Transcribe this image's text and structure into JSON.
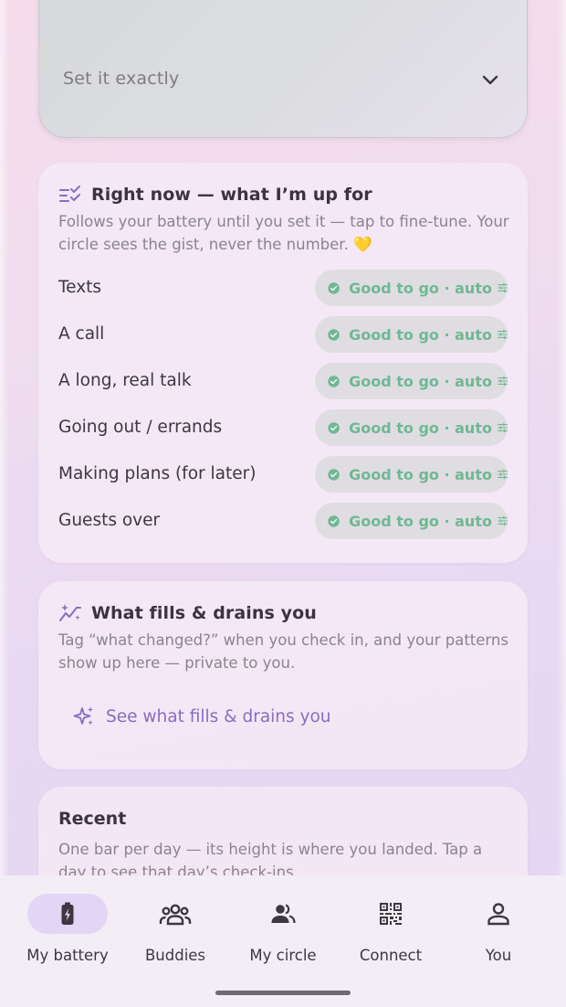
{
  "colors": {
    "accent": "#8a6cc0",
    "status_ok": "#6fb894",
    "nav_active_bg": "#e3d5f5"
  },
  "select": {
    "label": "Set it exactly",
    "icon": "chevron-down-icon"
  },
  "right_now": {
    "title": "Right now — what I’m up for",
    "icon": "tune-check-icon",
    "description": "Follows your battery until you set it — tap to fine-tune. Your circle sees the gist, never the number. 💛",
    "rows": [
      {
        "label": "Texts",
        "status": "Good to go · auto"
      },
      {
        "label": "A call",
        "status": "Good to go · auto"
      },
      {
        "label": "A long, real talk",
        "status": "Good to go · auto"
      },
      {
        "label": "Going out / errands",
        "status": "Good to go · auto"
      },
      {
        "label": "Making plans (for later)",
        "status": "Good to go · auto"
      },
      {
        "label": "Guests over",
        "status": "Good to go · auto"
      }
    ]
  },
  "fills_drains": {
    "title": "What fills & drains you",
    "icon": "sparkle-chart-icon",
    "description": "Tag “what changed?” when you check in, and your patterns show up here — private to you.",
    "link": "See what fills & drains you"
  },
  "recent": {
    "title": "Recent",
    "description": "One bar per day — its height is where you landed. Tap a day to see that day’s check-ins."
  },
  "nav": {
    "items": [
      {
        "label": "My battery",
        "icon": "battery-bolt-icon",
        "active": true
      },
      {
        "label": "Buddies",
        "icon": "group-icon",
        "active": false
      },
      {
        "label": "My circle",
        "icon": "people-icon",
        "active": false
      },
      {
        "label": "Connect",
        "icon": "qr-code-icon",
        "active": false
      },
      {
        "label": "You",
        "icon": "person-icon",
        "active": false
      }
    ]
  }
}
